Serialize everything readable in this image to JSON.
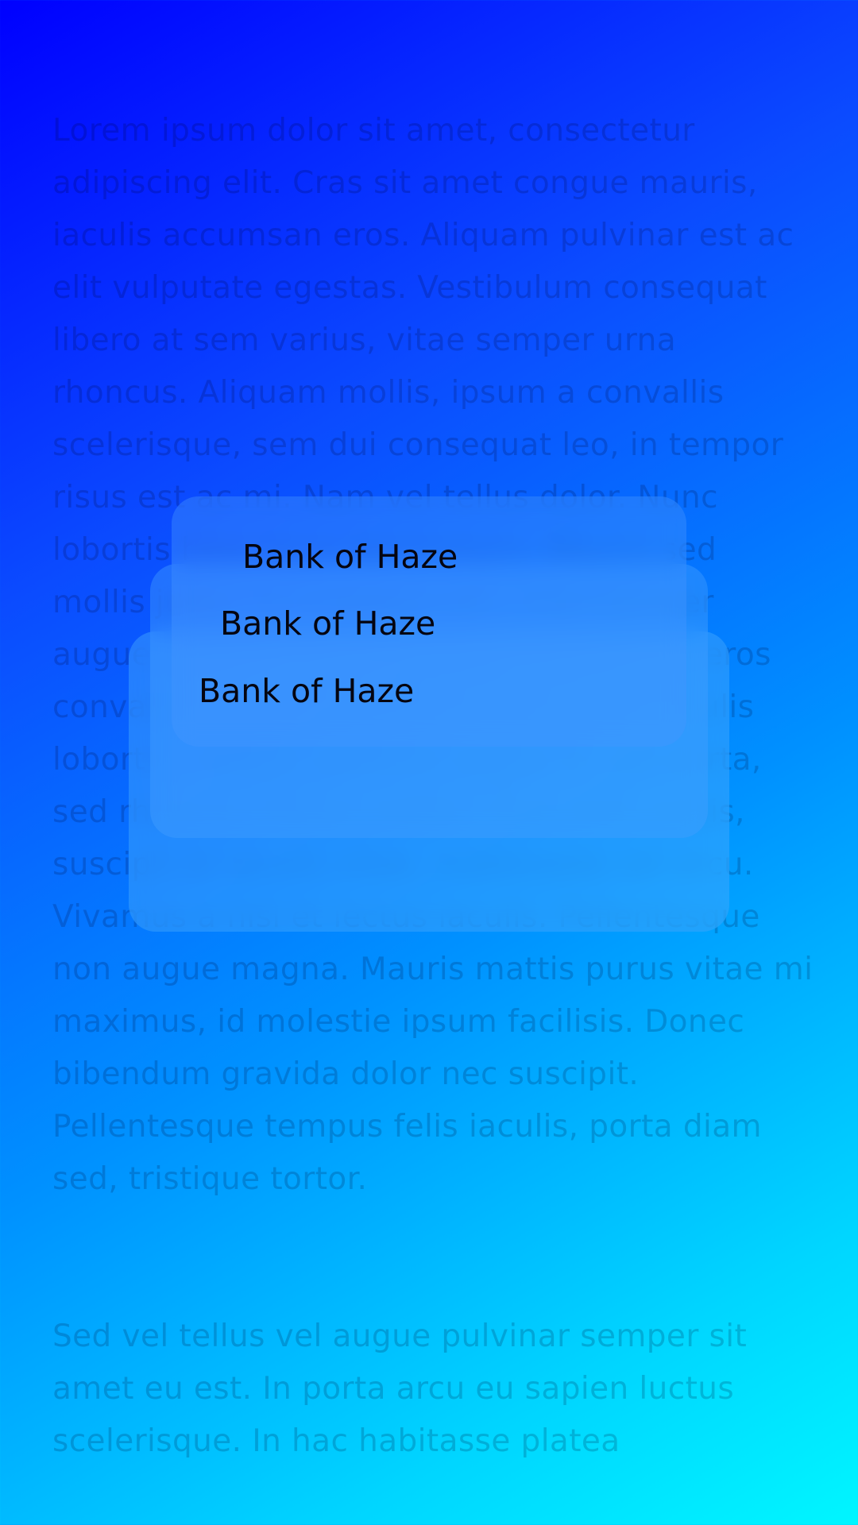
{
  "background": {
    "paragraph_1": "Lorem ipsum dolor sit amet, consectetur adipiscing elit. Cras sit amet congue mauris, iaculis accumsan eros. Aliquam pulvinar est ac elit vulputate egestas. Vestibulum consequat libero at sem varius, vitae semper urna rhoncus. Aliquam mollis, ipsum a convallis scelerisque, sem dui consequat leo, in tempor risus est ac mi. Nam vel tellus dolor. Nunc lobortis bibendum fermentum. Mauris sed mollis justo, eu tristique elit. Cras semper augue a tortor tempus, vitae vestibulum eros convallis. Integer ut tellus eget tortor iaculis lobortis. Integer posuere augue ac elit porta, sed rhoncus massa mattis. Duis eros turpis, suscipit at iaculis vitae, malesuada vel arcu. Vivamus a nisl et lectus iaculis. Pellentesque non augue magna. Mauris mattis purus vitae mi maximus, id molestie ipsum facilisis. Donec bibendum gravida dolor nec suscipit. Pellentesque tempus felis iaculis, porta diam sed, tristique tortor.",
    "paragraph_2": "Sed vel tellus vel augue pulvinar semper sit amet eu est. In porta arcu eu sapien luctus scelerisque. In hac habitasse platea"
  },
  "cards": [
    {
      "label": "Bank of Haze"
    },
    {
      "label": "Bank of Haze"
    },
    {
      "label": "Bank of Haze"
    }
  ],
  "colors": {
    "gradient_start": "#0000ff",
    "gradient_end": "#00f6ff",
    "label_text": "#050510"
  }
}
